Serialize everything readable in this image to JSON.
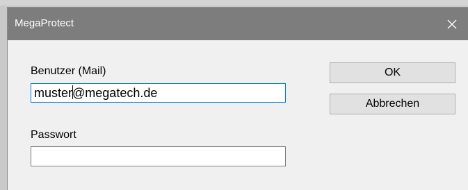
{
  "window": {
    "title": "MegaProtect",
    "close_label": "Close"
  },
  "form": {
    "user_label": "Benutzer (Mail)",
    "user_value_before_caret": "muster",
    "user_value_after_caret": "@megatech.de",
    "password_label": "Passwort",
    "password_value": ""
  },
  "buttons": {
    "ok_label": "OK",
    "cancel_label": "Abbrechen"
  },
  "icons": {
    "close": "close-icon"
  },
  "colors": {
    "titlebar": "#7d7d7d",
    "focus_border": "#0078d7",
    "dialog_bg": "#f0f0f0"
  }
}
